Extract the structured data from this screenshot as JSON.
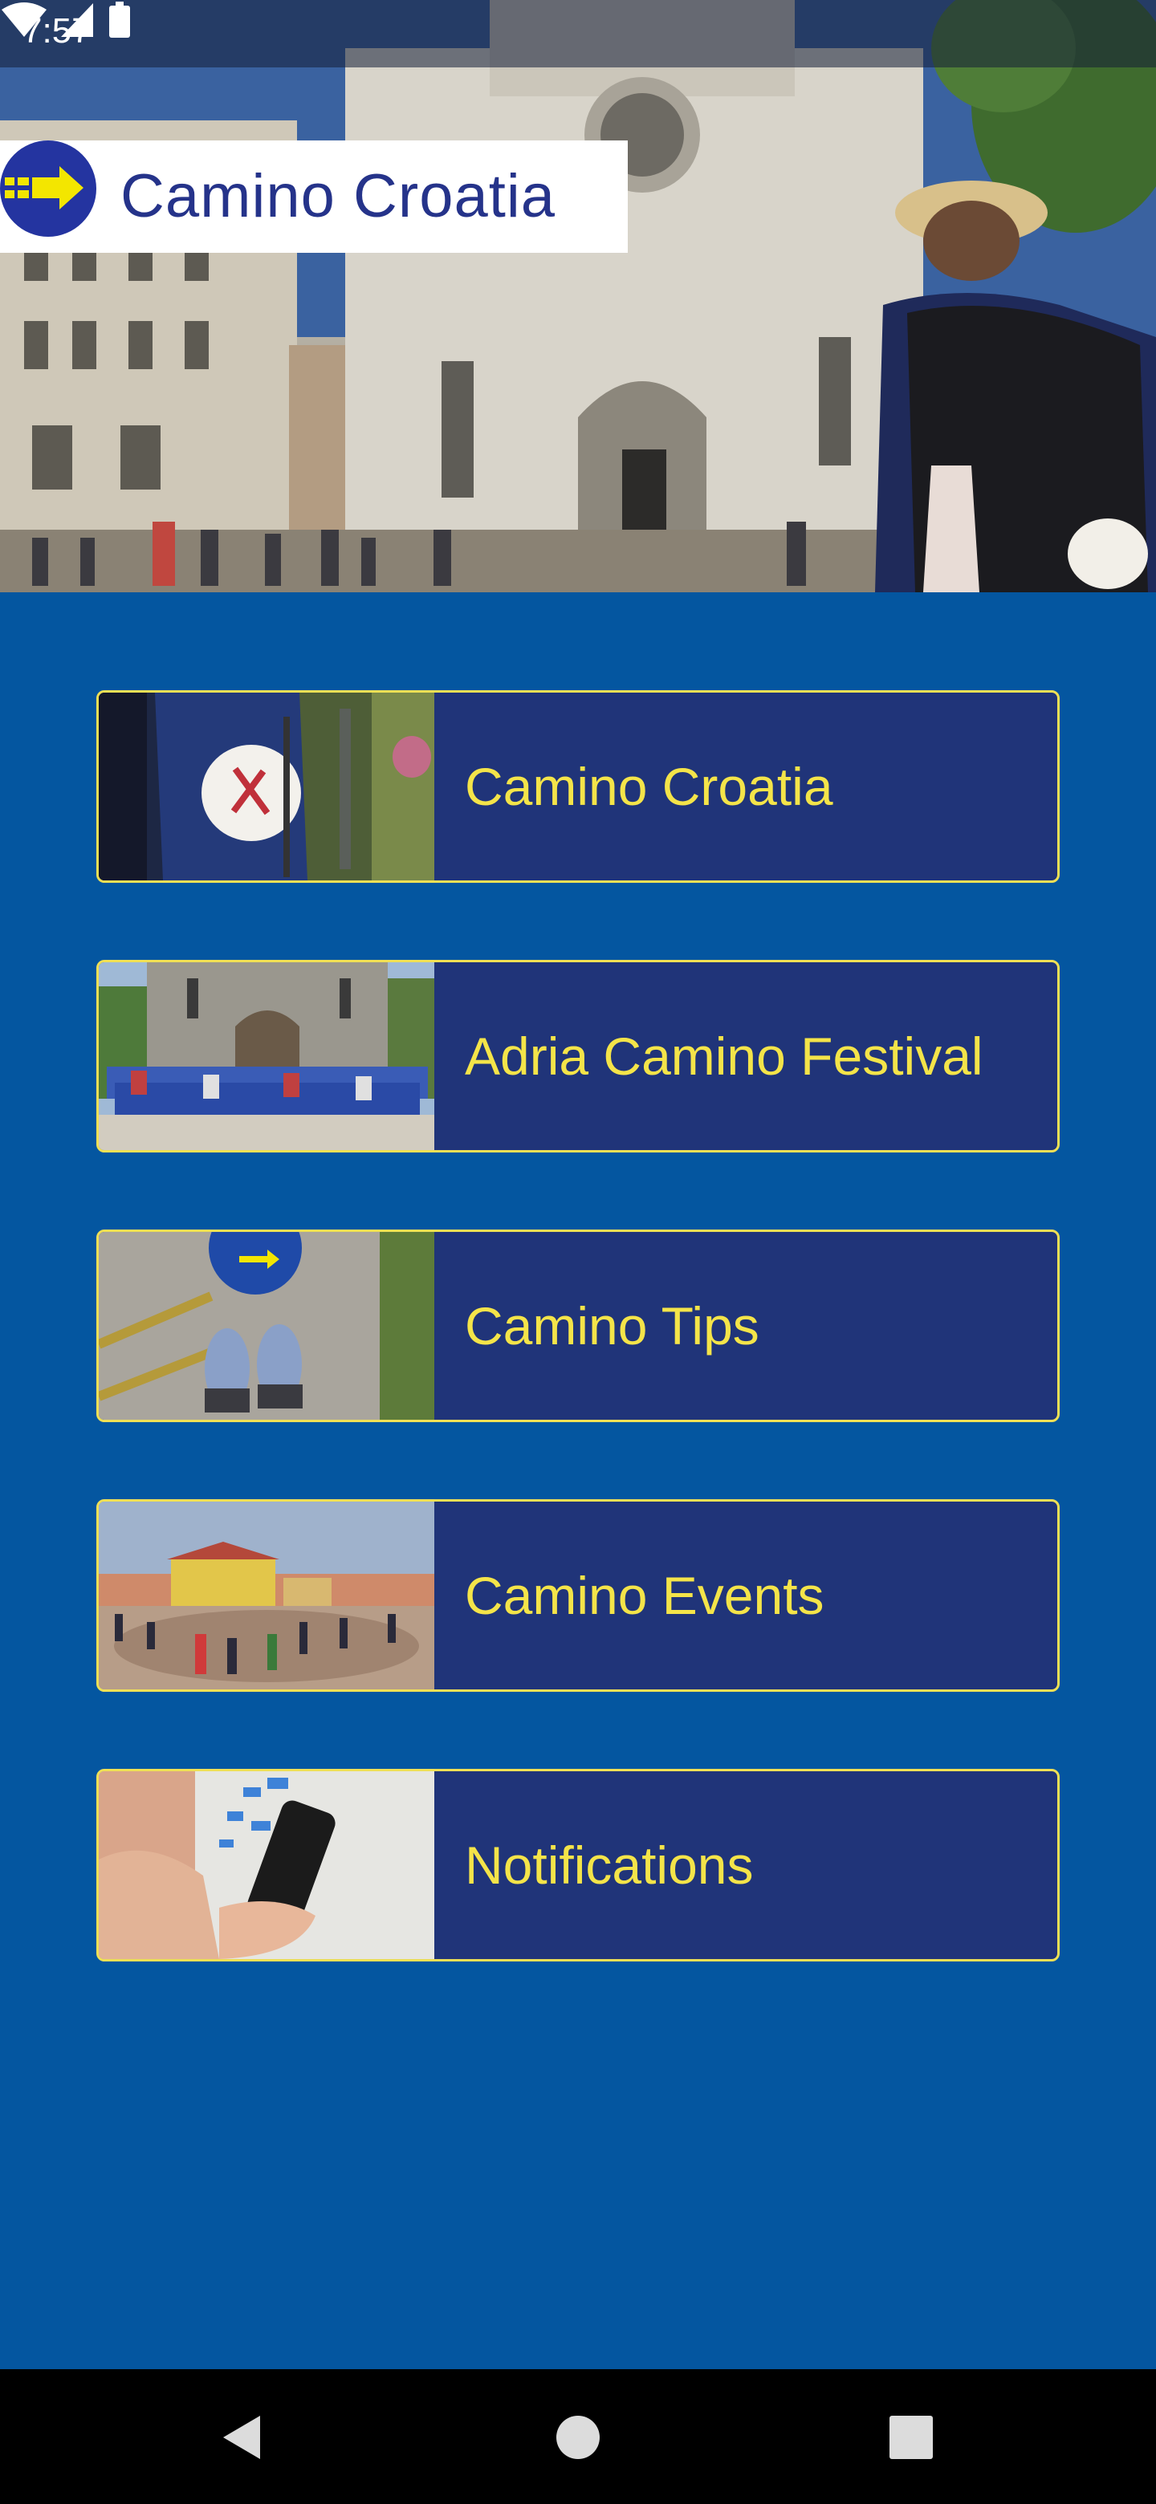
{
  "status_bar": {
    "time": "7:57",
    "icons": [
      "wifi-icon",
      "cellular-signal-icon",
      "battery-icon"
    ]
  },
  "header": {
    "logo_text": "Camino Croatia",
    "logo_colors": {
      "circle": "#2434a0",
      "arrow": "#f3e600",
      "text": "#25338a"
    }
  },
  "menu": {
    "items": [
      {
        "label": "Camino Croatia",
        "thumb": "backpack-scallop-shell-photo"
      },
      {
        "label": "Adria Camino Festival",
        "thumb": "group-in-front-of-church-photo"
      },
      {
        "label": "Camino Tips",
        "thumb": "hiking-shoes-and-poles-photo"
      },
      {
        "label": "Camino Events",
        "thumb": "town-square-gathering-photo"
      },
      {
        "label": "Notifications",
        "thumb": "hand-holding-phone-photo"
      }
    ],
    "colors": {
      "background": "#0456a0",
      "card": "#203479",
      "border": "#f0e055",
      "text": "#f4e449"
    }
  },
  "nav_bar": {
    "buttons": [
      "back-icon",
      "home-icon",
      "recents-icon"
    ]
  }
}
